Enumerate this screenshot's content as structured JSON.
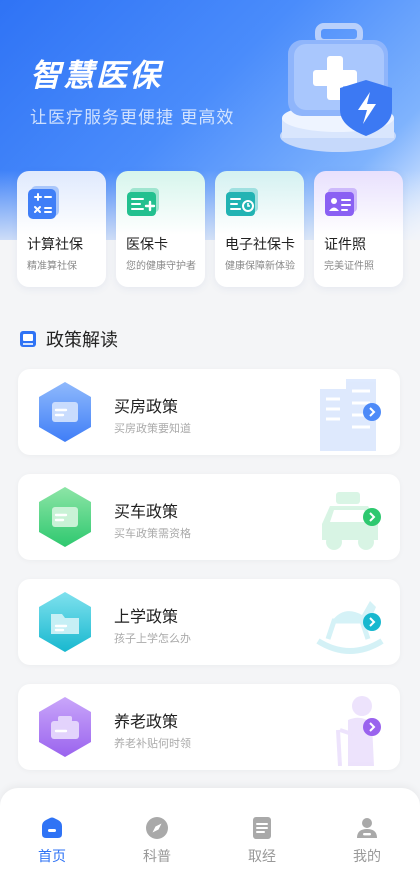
{
  "hero": {
    "title": "智慧医保",
    "subtitle": "让医疗服务更便捷 更高效"
  },
  "quick_actions": [
    {
      "title": "计算社保",
      "subtitle": "精准算社保",
      "icon": "calculator-icon",
      "color": "#3f7ef7"
    },
    {
      "title": "医保卡",
      "subtitle": "您的健康守护者",
      "icon": "medical-card-icon",
      "color": "#23c08f"
    },
    {
      "title": "电子社保卡",
      "subtitle": "健康保障新体验",
      "icon": "e-social-card-icon",
      "color": "#22b3b3"
    },
    {
      "title": "证件照",
      "subtitle": "完美证件照",
      "icon": "id-photo-icon",
      "color": "#8a60f3"
    }
  ],
  "policy": {
    "section_title": "政策解读",
    "items": [
      {
        "title": "买房政策",
        "subtitle": "买房政策要知道",
        "icon": "house-policy-icon",
        "color": "#4d8af8"
      },
      {
        "title": "买车政策",
        "subtitle": "买车政策需资格",
        "icon": "car-policy-icon",
        "color": "#2ec86f"
      },
      {
        "title": "上学政策",
        "subtitle": "孩子上学怎么办",
        "icon": "school-policy-icon",
        "color": "#18b8cf"
      },
      {
        "title": "养老政策",
        "subtitle": "养老补贴何时领",
        "icon": "pension-policy-icon",
        "color": "#9a63ee"
      }
    ]
  },
  "tabbar": {
    "items": [
      {
        "label": "首页",
        "icon": "home-icon",
        "active": true
      },
      {
        "label": "科普",
        "icon": "compass-icon",
        "active": false
      },
      {
        "label": "取经",
        "icon": "document-icon",
        "active": false
      },
      {
        "label": "我的",
        "icon": "user-icon",
        "active": false
      }
    ]
  },
  "colors": {
    "brand": "#2f73f5",
    "background": "#f4f5f7",
    "tab_inactive": "#999999"
  }
}
